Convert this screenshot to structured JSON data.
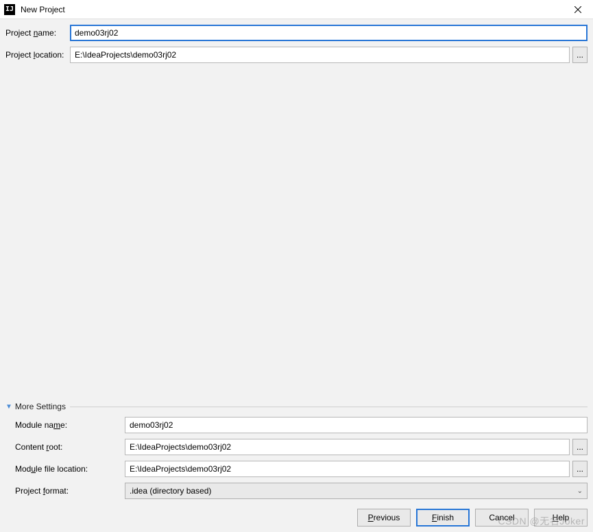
{
  "window": {
    "title": "New Project",
    "app_icon_text": "IJ"
  },
  "top": {
    "project_name_label_pre": "Project ",
    "project_name_label_m": "n",
    "project_name_label_post": "ame:",
    "project_name_value": "demo03rj02",
    "project_location_label_pre": "Project ",
    "project_location_label_m": "l",
    "project_location_label_post": "ocation:",
    "project_location_value": "E:\\IdeaProjects\\demo03rj02",
    "browse_label": "..."
  },
  "more": {
    "header": "More Settings",
    "module_name_label_pre": "Module na",
    "module_name_label_m": "m",
    "module_name_label_post": "e:",
    "module_name_value": "demo03rj02",
    "content_root_label_pre": "Content ",
    "content_root_label_m": "r",
    "content_root_label_post": "oot:",
    "content_root_value": "E:\\IdeaProjects\\demo03rj02",
    "module_file_label_pre": "Mod",
    "module_file_label_m": "u",
    "module_file_label_post": "le file location:",
    "module_file_value": "E:\\IdeaProjects\\demo03rj02",
    "project_format_label_pre": "Project ",
    "project_format_label_m": "f",
    "project_format_label_post": "ormat:",
    "project_format_value": ".idea (directory based)",
    "browse_label": "..."
  },
  "buttons": {
    "previous_pre": "",
    "previous_m": "P",
    "previous_post": "revious",
    "finish_pre": "",
    "finish_m": "F",
    "finish_post": "inish",
    "cancel": "Cancel",
    "help_pre": "",
    "help_m": "H",
    "help_post": "elp"
  },
  "watermark": "CSDN @无名Joker"
}
